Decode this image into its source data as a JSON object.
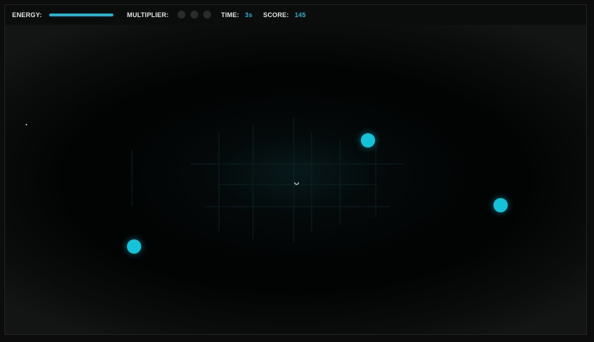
{
  "hud": {
    "energy": {
      "label": "ENERGY:",
      "level": 1.0
    },
    "multiplier": {
      "label": "MULTIPLIER:",
      "slots": 3,
      "active": 0
    },
    "time": {
      "label": "TIME:",
      "value": "3s"
    },
    "score": {
      "label": "SCORE:",
      "value": "145"
    }
  },
  "colors": {
    "accent": "#21b3cf",
    "orb": "#14c3da",
    "hud_background": "#0b0c0c",
    "inactive_dot": "#2a2b2b"
  },
  "icons": {
    "orb": "cyan-orb-icon",
    "player": "player-ship-icon",
    "multiplier_slot": "multiplier-dot-icon"
  }
}
